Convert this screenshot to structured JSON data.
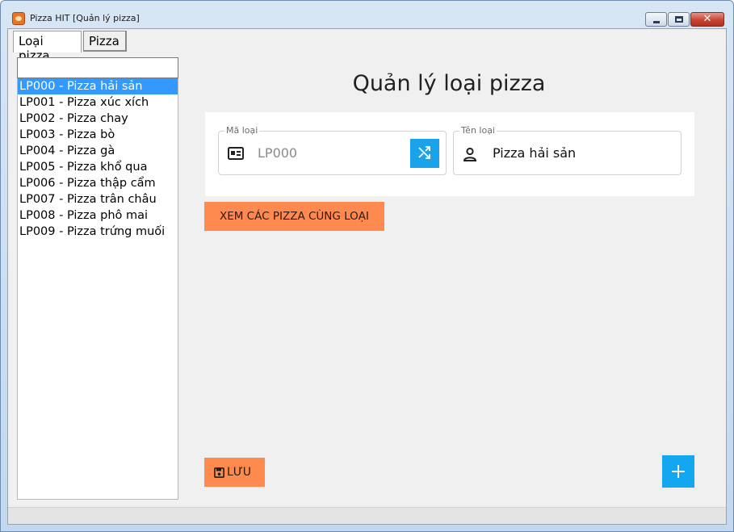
{
  "window": {
    "title": "Pizza HIT [Quản lý pizza]",
    "icon": "pizza-app-icon",
    "controls": [
      "minimize-icon",
      "maximize-icon",
      "close-icon"
    ],
    "close_glyph": "✕"
  },
  "tabs": [
    {
      "label": "Loại pizza",
      "active": true
    },
    {
      "label": "Pizza",
      "active": false
    }
  ],
  "search": {
    "value": "",
    "placeholder": ""
  },
  "list": {
    "items": [
      "LP000 - Pizza hải sản",
      "LP001 - Pizza xúc xích",
      "LP002 - Pizza chay",
      "LP003 - Pizza bò",
      "LP004 - Pizza gà",
      "LP005 - Pizza khổ qua",
      "LP006 - Pizza thập cẩm",
      "LP007 - Pizza trân châu",
      "LP008 - Pizza phô mai",
      "LP009 - Pizza trứng muối"
    ],
    "selected_index": 0
  },
  "main": {
    "title": "Quản lý loại pizza",
    "fields": {
      "ma_loai": {
        "label": "Mã loại",
        "value": "LP000",
        "icon": "id-card-icon",
        "action_icon": "shuffle-icon"
      },
      "ten_loai": {
        "label": "Tên loại",
        "value": "Pizza hải sản",
        "icon": "person-icon"
      }
    },
    "view_button_label": "XEM CÁC PIZZA CÙNG LOẠI",
    "save_button_label": "LƯU",
    "save_icon": "floppy-disk-icon",
    "add_icon": "plus-icon"
  },
  "colors": {
    "accent_orange": "#ff8a50",
    "accent_blue": "#12a7f0",
    "selection_blue": "#3399ff",
    "background": "#f0f0f0"
  }
}
